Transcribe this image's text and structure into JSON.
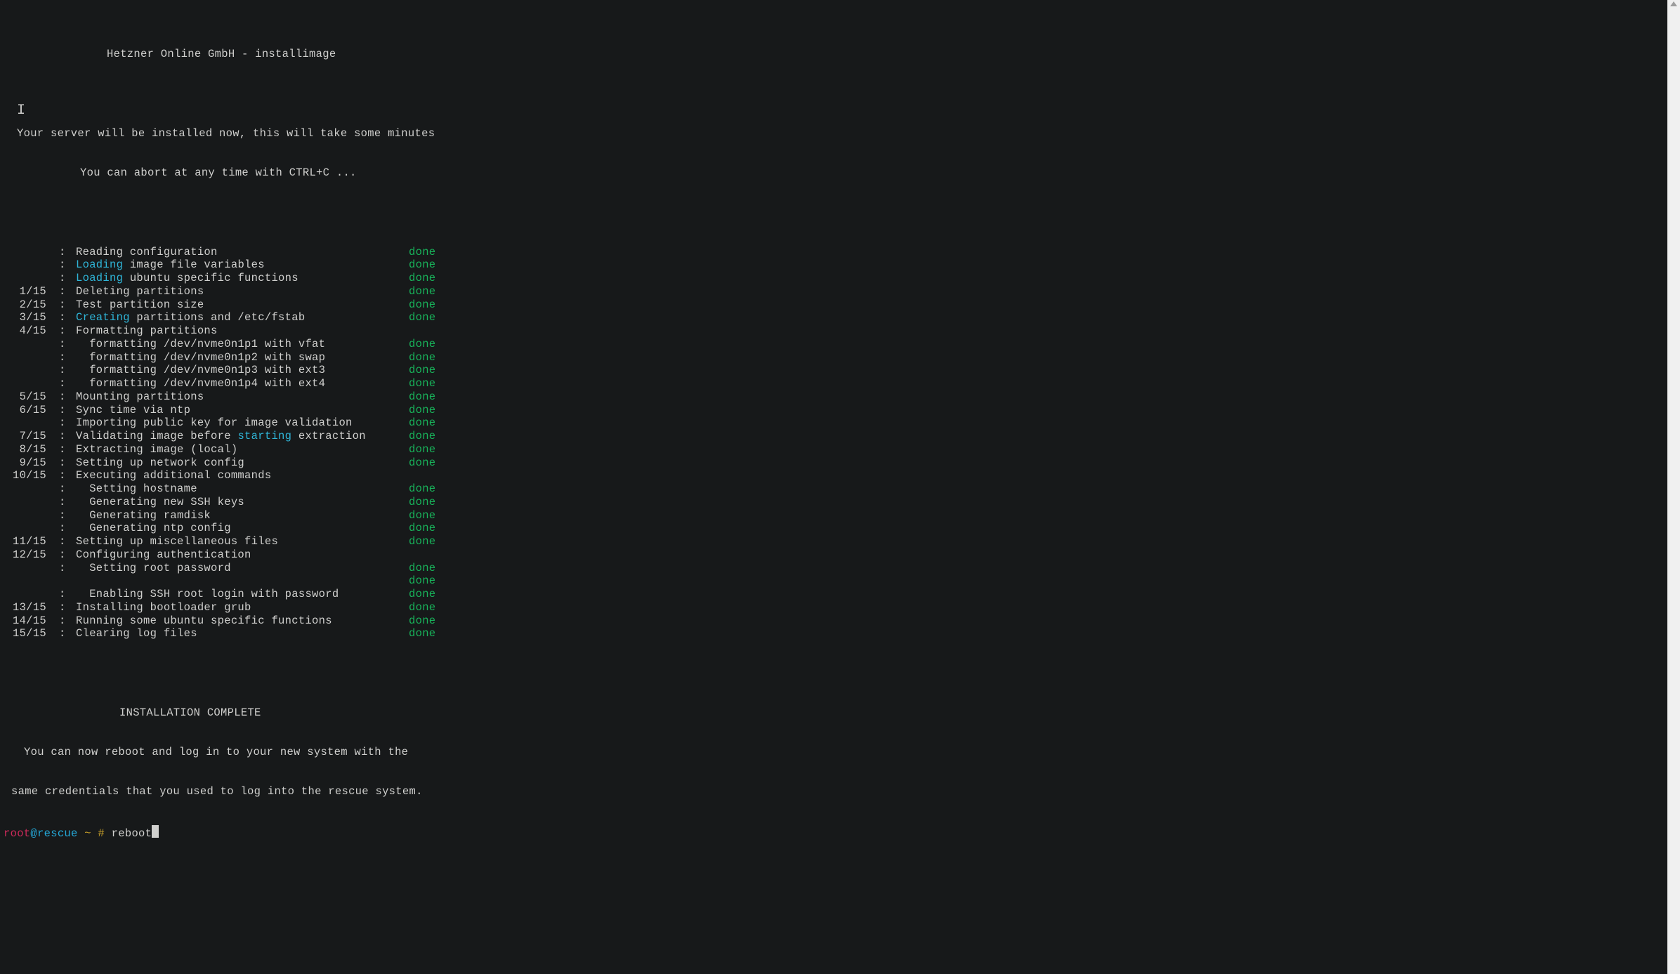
{
  "header": "Hetzner Online GmbH - installimage",
  "intro_line1": "Your server will be installed now, this will take some minutes",
  "intro_line2": "You can abort at any time with CTRL+C ...",
  "done": "done",
  "rows": [
    {
      "step": "",
      "text": "Reading configuration",
      "status": "done"
    },
    {
      "step": "",
      "hl": "Loading",
      "text": " image file variables",
      "status": "done"
    },
    {
      "step": "",
      "hl": "Loading",
      "text": " ubuntu specific functions",
      "status": "done"
    },
    {
      "step": "1/15",
      "text": "Deleting partitions",
      "status": "done"
    },
    {
      "step": "2/15",
      "text": "Test partition size",
      "status": "done"
    },
    {
      "step": "3/15",
      "hl": "Creating",
      "text": " partitions and /etc/fstab",
      "status": "done"
    },
    {
      "step": "4/15",
      "text": "Formatting partitions",
      "status": ""
    },
    {
      "step": "",
      "text": "  formatting /dev/nvme0n1p1 with vfat",
      "status": "done"
    },
    {
      "step": "",
      "text": "  formatting /dev/nvme0n1p2 with swap",
      "status": "done"
    },
    {
      "step": "",
      "text": "  formatting /dev/nvme0n1p3 with ext3",
      "status": "done"
    },
    {
      "step": "",
      "text": "  formatting /dev/nvme0n1p4 with ext4",
      "status": "done"
    },
    {
      "step": "5/15",
      "text": "Mounting partitions",
      "status": "done"
    },
    {
      "step": "6/15",
      "text": "Sync time via ntp",
      "status": "done"
    },
    {
      "step": "",
      "text": "Importing public key for image validation",
      "status": "done"
    },
    {
      "step": "7/15",
      "midhl": true,
      "pre": "Validating image before ",
      "hl": "starting",
      "post": " extraction",
      "status": "done"
    },
    {
      "step": "8/15",
      "text": "Extracting image (local)",
      "status": "done"
    },
    {
      "step": "9/15",
      "text": "Setting up network config",
      "status": "done"
    },
    {
      "step": "10/15",
      "text": "Executing additional commands",
      "status": ""
    },
    {
      "step": "",
      "text": "  Setting hostname",
      "status": "done"
    },
    {
      "step": "",
      "text": "  Generating new SSH keys",
      "status": "done"
    },
    {
      "step": "",
      "text": "  Generating ramdisk",
      "status": "done"
    },
    {
      "step": "",
      "text": "  Generating ntp config",
      "status": "done"
    },
    {
      "step": "11/15",
      "text": "Setting up miscellaneous files",
      "status": "done"
    },
    {
      "step": "12/15",
      "text": "Configuring authentication",
      "status": ""
    },
    {
      "step": "",
      "text": "  Setting root password",
      "status": "done"
    },
    {
      "step": "",
      "blank": true,
      "status": "done"
    },
    {
      "step": "",
      "text": "  Enabling SSH root login with password",
      "status": "done"
    },
    {
      "step": "13/15",
      "text": "Installing bootloader grub",
      "status": "done"
    },
    {
      "step": "14/15",
      "text": "Running some ubuntu specific functions",
      "status": "done"
    },
    {
      "step": "15/15",
      "text": "Clearing log files",
      "status": "done"
    }
  ],
  "complete": "INSTALLATION COMPLETE",
  "footer1": "You can now reboot and log in to your new system with the",
  "footer2": "same credentials that you used to log into the rescue system.",
  "prompt": {
    "user": "root",
    "at": "@",
    "host": "rescue",
    "path": " ~ # ",
    "cmd": "reboot"
  }
}
